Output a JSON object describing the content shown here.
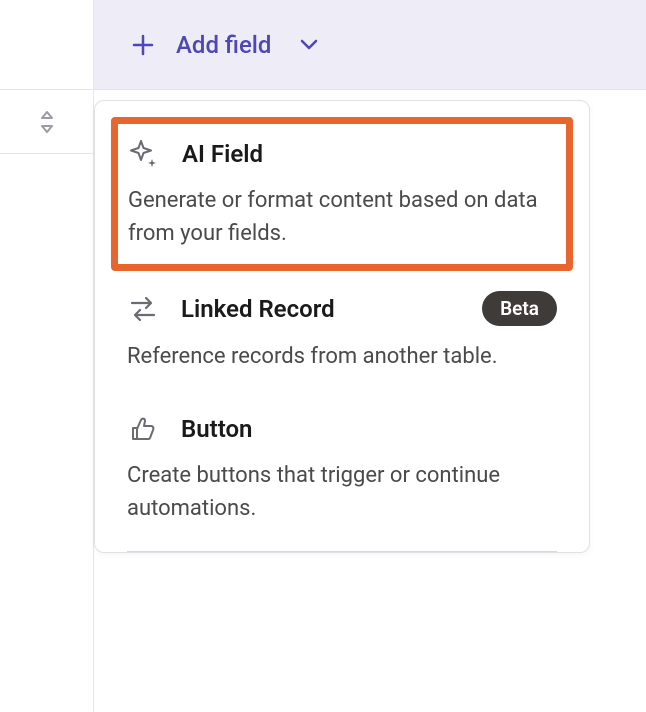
{
  "header": {
    "add_field_label": "Add field"
  },
  "dropdown": {
    "options": [
      {
        "title": "AI Field",
        "description": "Generate or format content based on data from your fields.",
        "highlighted": true,
        "badge": null
      },
      {
        "title": "Linked Record",
        "description": "Reference records from another table.",
        "highlighted": false,
        "badge": "Beta"
      },
      {
        "title": "Button",
        "description": "Create buttons that trigger or continue automations.",
        "highlighted": false,
        "badge": null
      }
    ]
  }
}
